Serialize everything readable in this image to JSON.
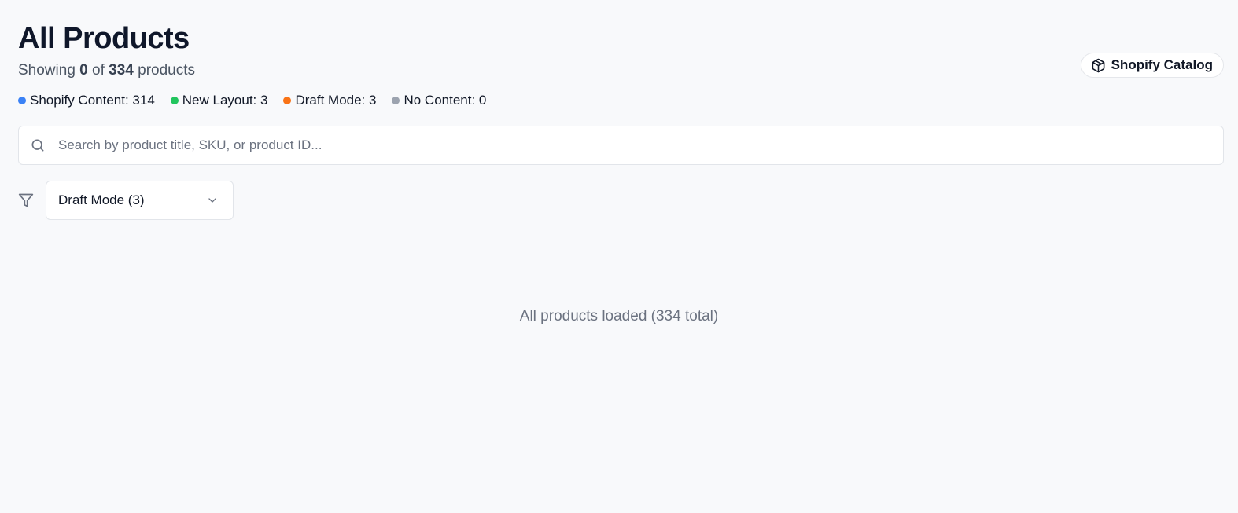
{
  "header": {
    "title": "All Products",
    "showing_prefix": "Showing",
    "showing_count": "0",
    "showing_of": "of",
    "total_count": "334",
    "showing_suffix": "products"
  },
  "catalog_button": {
    "label": "Shopify Catalog",
    "icon": "package-icon"
  },
  "stats": [
    {
      "label": "Shopify Content: 314",
      "color": "#3b82f6"
    },
    {
      "label": "New Layout: 3",
      "color": "#22c55e"
    },
    {
      "label": "Draft Mode: 3",
      "color": "#f97316"
    },
    {
      "label": "No Content: 0",
      "color": "#9ca3af"
    }
  ],
  "search": {
    "placeholder": "Search by product title, SKU, or product ID...",
    "value": "",
    "icon": "search-icon"
  },
  "filter": {
    "icon": "filter-icon",
    "selected": "Draft Mode (3)"
  },
  "empty_state": {
    "message": "All products loaded (334 total)"
  }
}
